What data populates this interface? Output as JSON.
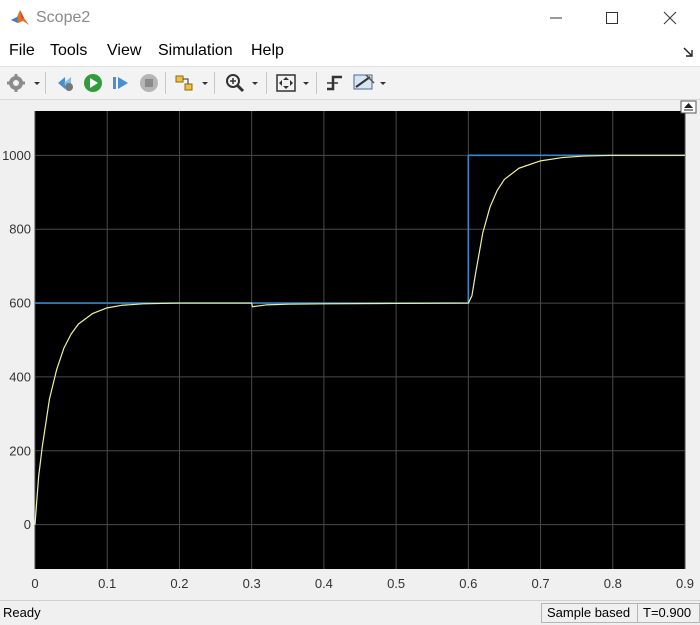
{
  "window": {
    "title": "Scope2"
  },
  "menu": {
    "items": [
      "File",
      "Tools",
      "View",
      "Simulation",
      "Help"
    ]
  },
  "status": {
    "ready": "Ready",
    "mode": "Sample based",
    "time": "T=0.900"
  },
  "colors": {
    "plot_bg": "#000000",
    "grid": "#4a4a4a",
    "axis_text": "#ffffff",
    "reference_line": "#3a86c8",
    "response_line": "#f0f0a0"
  },
  "chart_data": {
    "type": "line",
    "title": "",
    "xlabel": "",
    "ylabel": "",
    "xlim": [
      0,
      0.9
    ],
    "ylim": [
      -120,
      1120
    ],
    "xticks": [
      0,
      0.1,
      0.2,
      0.3,
      0.4,
      0.5,
      0.6,
      0.7,
      0.8,
      0.9
    ],
    "yticks": [
      0,
      200,
      400,
      600,
      800,
      1000
    ],
    "grid": true,
    "series": [
      {
        "x": [
          0,
          0.6,
          0.6,
          0.9
        ],
        "y": [
          600,
          600,
          1000,
          1000
        ]
      },
      {
        "x": [
          0,
          0.005,
          0.01,
          0.02,
          0.03,
          0.04,
          0.05,
          0.06,
          0.08,
          0.1,
          0.12,
          0.15,
          0.2,
          0.3,
          0.301,
          0.32,
          0.35,
          0.4,
          0.5,
          0.6,
          0.605,
          0.61,
          0.62,
          0.63,
          0.64,
          0.65,
          0.67,
          0.7,
          0.73,
          0.76,
          0.8,
          0.9
        ],
        "y": [
          0,
          130,
          210,
          340,
          420,
          478,
          516,
          543,
          572,
          587,
          594,
          598,
          600,
          600,
          590,
          595,
          597,
          598,
          599,
          600,
          620,
          680,
          790,
          860,
          905,
          935,
          965,
          985,
          994,
          998,
          1000,
          1000
        ]
      }
    ]
  }
}
